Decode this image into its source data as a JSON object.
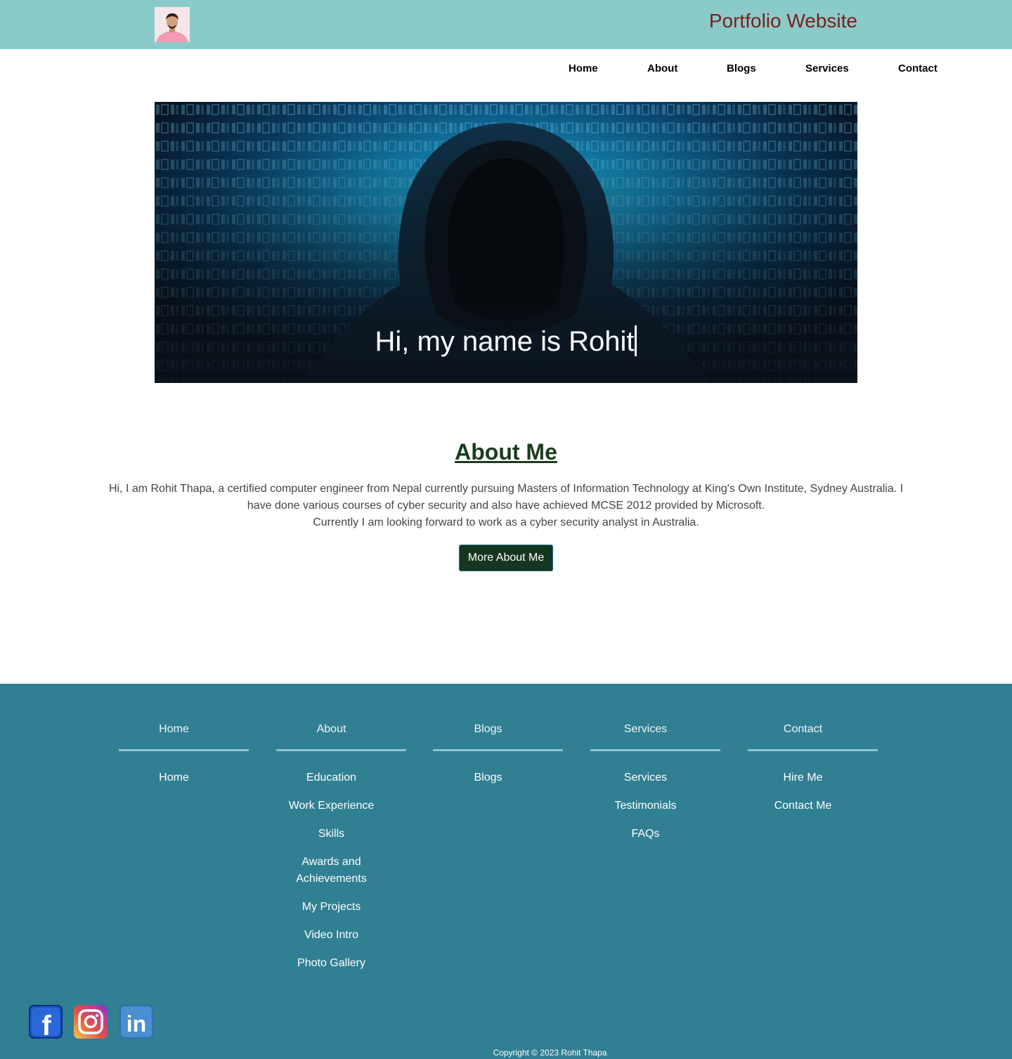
{
  "header": {
    "site_title": "Portfolio Website"
  },
  "nav": {
    "items": [
      {
        "label": "Home"
      },
      {
        "label": "About"
      },
      {
        "label": "Blogs"
      },
      {
        "label": "Services"
      },
      {
        "label": "Contact"
      }
    ]
  },
  "hero": {
    "headline": "Hi, my name is Rohit"
  },
  "about": {
    "title": "About Me",
    "paragraph1": "Hi, I am Rohit Thapa, a certified computer engineer from Nepal currently pursuing Masters of Information Technology at King's Own Institute, Sydney Australia. I have done various courses of cyber security and also have achieved MCSE 2012 provided by Microsoft.",
    "paragraph2": "Currently I am looking forward to work as a cyber security analyst in Australia.",
    "button_label": "More About Me"
  },
  "footer": {
    "columns": [
      {
        "heading": "Home",
        "links": [
          "Home"
        ]
      },
      {
        "heading": "About",
        "links": [
          "Education",
          "Work Experience",
          "Skills",
          "Awards and Achievements",
          "My Projects",
          "Video Intro",
          "Photo Gallery"
        ]
      },
      {
        "heading": "Blogs",
        "links": [
          "Blogs"
        ]
      },
      {
        "heading": "Services",
        "links": [
          "Services",
          "Testimonials",
          "FAQs"
        ]
      },
      {
        "heading": "Contact",
        "links": [
          "Hire Me",
          "Contact Me"
        ]
      }
    ],
    "social": [
      {
        "icon": "facebook-icon",
        "glyph": "f"
      },
      {
        "icon": "instagram-icon"
      },
      {
        "icon": "linkedin-icon",
        "glyph": "in"
      }
    ],
    "copyright": "Copyright © 2023 Rohit Thapa"
  },
  "colors": {
    "topbar": "#8acbc9",
    "title": "#7b1f1f",
    "about_title": "#1a3d1d",
    "button": "#15361f",
    "footer": "#307f92"
  }
}
